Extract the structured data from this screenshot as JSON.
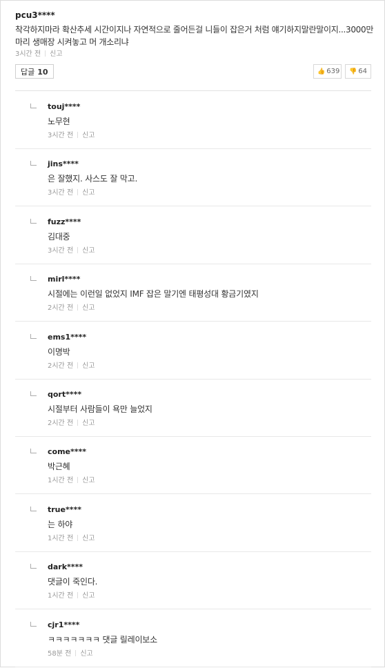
{
  "comment": {
    "author": "pcu3****",
    "text": "착각하지마라 확산추세 시간이지나 자연적으로 줄어든걸 니들이 잡은거 처럼 얘기하지말란말이지...3000만마리 생매장 시켜놓고 머 개소리냐",
    "time": "3시간 전",
    "report_label": "신고",
    "reply_label": "답글",
    "reply_count": "10",
    "likes": "639",
    "dislikes": "64"
  },
  "replies": [
    {
      "author": "touj****",
      "text": "노무현",
      "time": "3시간 전",
      "report": "신고"
    },
    {
      "author": "jins****",
      "text": "은 잘했지. 사스도 잘 막고.",
      "time": "3시간 전",
      "report": "신고"
    },
    {
      "author": "fuzz****",
      "text": "김대중",
      "time": "3시간 전",
      "report": "신고"
    },
    {
      "author": "mirl****",
      "text": "시절에는 이런일 없었지 IMF 잡은 말기엔 태평성대 황금기였지",
      "time": "2시간 전",
      "report": "신고"
    },
    {
      "author": "ems1****",
      "text": "이명박",
      "time": "2시간 전",
      "report": "신고"
    },
    {
      "author": "qort****",
      "text": "시절부터 사람들이 욕만 늘었지",
      "time": "2시간 전",
      "report": "신고"
    },
    {
      "author": "come****",
      "text": "박근혜",
      "time": "1시간 전",
      "report": "신고"
    },
    {
      "author": "true****",
      "text": "는 하야",
      "time": "1시간 전",
      "report": "신고"
    },
    {
      "author": "dark****",
      "text": "댓글이 죽인다.",
      "time": "1시간 전",
      "report": "신고"
    },
    {
      "author": "cjr1****",
      "text": "ㅋㅋㅋㅋㅋㅋㅋ 댓글 릴레이보소",
      "time": "58분 전",
      "report": "신고"
    }
  ]
}
